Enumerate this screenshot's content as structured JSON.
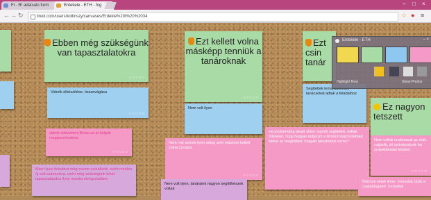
{
  "browser": {
    "tabs": [
      {
        "label": "Fi - R! adatsalo furm",
        "active": false
      },
      {
        "label": "Entekele - ETH - fog",
        "active": true
      }
    ],
    "window_controls": [
      "–",
      "□",
      "×"
    ],
    "url": "linoit.com/users/kollinszy/canvases/Erdekle%20t%20%2034"
  },
  "panel": {
    "title": "Entekele - ETH",
    "footer_left": "Highlight Now",
    "footer_right": "Show Photos",
    "swatch_colors": [
      "#f2d84f",
      "#a9dba6",
      "#8ec7ef",
      "#f59ac6"
    ]
  },
  "notes": {
    "n1": "Ebben még szükségünk van tapasztalatokra",
    "n2": "Ezt kellett volna másképp tenniük a tanároknak",
    "n3": "Ezt csin tanár",
    "n4": "Ez nagyon tetszett",
    "b1": "Videók elkészítése, összevágása",
    "b2": "Nem volt ilyen",
    "b3": "Segítettek lemaradóknak, tanácsokat adtak a feladathoz",
    "p1": "videót elkészíteni illetve az ál dolgok megismerkedése",
    "p2": "Nem volt semmi ilyen dolog amit másként kellett volna csinálni.",
    "p3": "Ha problémába akadt akkor egyből segítettek. Adtak ötleteket, hogy hogyan dolgozni a témáról kapcsolatban illetve az megoldást, hogyan tanulmányi során?",
    "p4": "Nem voltak unalmasak az órák. najjanlk, jól szórakoztunk ha projektfeladat közben",
    "v1": "Mivel ilyen feladatot még sosem csináltunk, ezért minden új volt számunkra, ezért még szükségünk lehet tapasztalatokra ilyen munka elvégzésében.",
    "v2": "Nem volt ilyen, tanáraink nagyon segítőkészek voltak",
    "v3": "Ötletünk lettek ilmre. Kedvelek bizto a csapatdagaért. Kedvélek",
    "rating": "○○○○○"
  }
}
